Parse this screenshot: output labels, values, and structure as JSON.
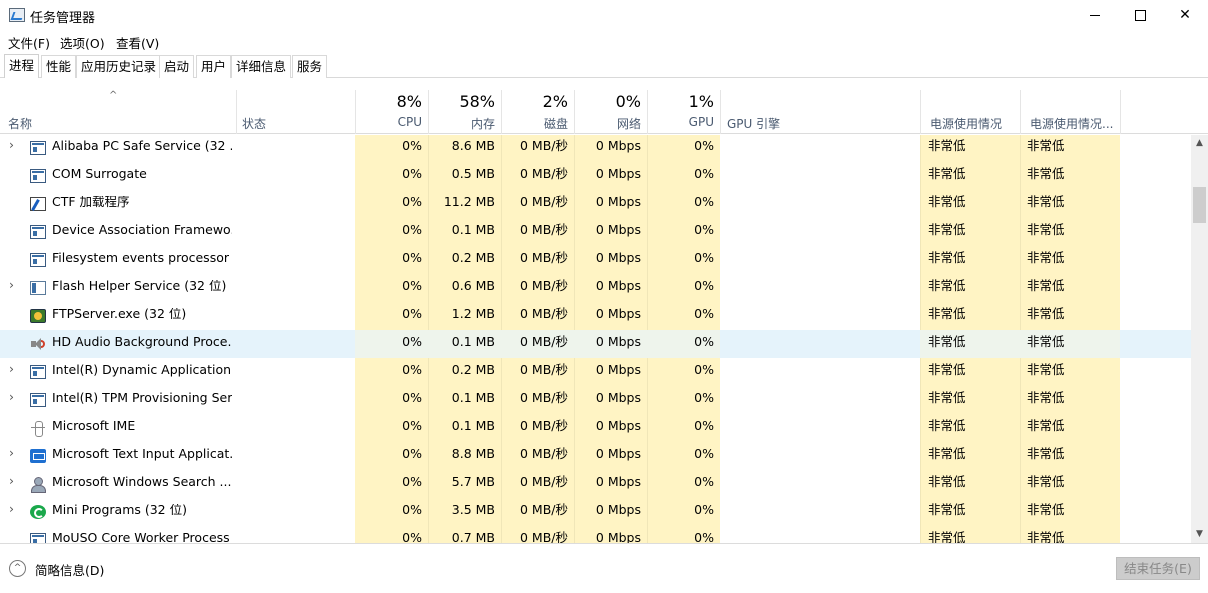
{
  "window": {
    "title": "任务管理器",
    "controls": {
      "minimize": "",
      "maximize": "",
      "close": "✕"
    }
  },
  "menu": [
    "文件(F)",
    "选项(O)",
    "查看(V)"
  ],
  "tabs": [
    "进程",
    "性能",
    "应用历史记录",
    "启动",
    "用户",
    "详细信息",
    "服务"
  ],
  "active_tab": "进程",
  "header": {
    "sort_caret": "^",
    "name": "名称",
    "status": "状态",
    "cpu_pct": "8%",
    "cpu": "CPU",
    "mem_pct": "58%",
    "mem": "内存",
    "disk_pct": "2%",
    "disk": "磁盘",
    "net_pct": "0%",
    "net": "网络",
    "gpu_pct": "1%",
    "gpu": "GPU",
    "gpu_engine": "GPU 引擎",
    "power": "电源使用情况",
    "power_trend": "电源使用情况..."
  },
  "rows": [
    {
      "expand": "›",
      "icon": "window-icon",
      "name": "Alibaba PC Safe Service (32 ...",
      "cpu": "0%",
      "mem": "8.6 MB",
      "disk": "0 MB/秒",
      "net": "0 Mbps",
      "gpu": "0%",
      "power": "非常低",
      "power_trend": "非常低"
    },
    {
      "expand": "",
      "icon": "window-icon",
      "name": "COM Surrogate",
      "cpu": "0%",
      "mem": "0.5 MB",
      "disk": "0 MB/秒",
      "net": "0 Mbps",
      "gpu": "0%",
      "power": "非常低",
      "power_trend": "非常低"
    },
    {
      "expand": "",
      "icon": "ctf-icon",
      "name": "CTF 加载程序",
      "cpu": "0%",
      "mem": "11.2 MB",
      "disk": "0 MB/秒",
      "net": "0 Mbps",
      "gpu": "0%",
      "power": "非常低",
      "power_trend": "非常低"
    },
    {
      "expand": "",
      "icon": "window-icon",
      "name": "Device Association Framewo...",
      "cpu": "0%",
      "mem": "0.1 MB",
      "disk": "0 MB/秒",
      "net": "0 Mbps",
      "gpu": "0%",
      "power": "非常低",
      "power_trend": "非常低"
    },
    {
      "expand": "",
      "icon": "window-icon",
      "name": "Filesystem events processor",
      "cpu": "0%",
      "mem": "0.2 MB",
      "disk": "0 MB/秒",
      "net": "0 Mbps",
      "gpu": "0%",
      "power": "非常低",
      "power_trend": "非常低"
    },
    {
      "expand": "›",
      "icon": "flash-icon",
      "name": "Flash Helper Service (32 位)",
      "cpu": "0%",
      "mem": "0.6 MB",
      "disk": "0 MB/秒",
      "net": "0 Mbps",
      "gpu": "0%",
      "power": "非常低",
      "power_trend": "非常低"
    },
    {
      "expand": "",
      "icon": "ftp-icon",
      "name": "FTPServer.exe (32 位)",
      "cpu": "0%",
      "mem": "1.2 MB",
      "disk": "0 MB/秒",
      "net": "0 Mbps",
      "gpu": "0%",
      "power": "非常低",
      "power_trend": "非常低"
    },
    {
      "expand": "",
      "icon": "speaker-icon",
      "name": "HD Audio Background Proce...",
      "cpu": "0%",
      "mem": "0.1 MB",
      "disk": "0 MB/秒",
      "net": "0 Mbps",
      "gpu": "0%",
      "power": "非常低",
      "power_trend": "非常低",
      "highlight": true
    },
    {
      "expand": "›",
      "icon": "window-icon",
      "name": "Intel(R) Dynamic Application ...",
      "cpu": "0%",
      "mem": "0.2 MB",
      "disk": "0 MB/秒",
      "net": "0 Mbps",
      "gpu": "0%",
      "power": "非常低",
      "power_trend": "非常低"
    },
    {
      "expand": "›",
      "icon": "window-icon",
      "name": "Intel(R) TPM Provisioning Ser...",
      "cpu": "0%",
      "mem": "0.1 MB",
      "disk": "0 MB/秒",
      "net": "0 Mbps",
      "gpu": "0%",
      "power": "非常低",
      "power_trend": "非常低"
    },
    {
      "expand": "",
      "icon": "ime-icon",
      "name": "Microsoft IME",
      "cpu": "0%",
      "mem": "0.1 MB",
      "disk": "0 MB/秒",
      "net": "0 Mbps",
      "gpu": "0%",
      "power": "非常低",
      "power_trend": "非常低"
    },
    {
      "expand": "›",
      "icon": "keyboard-icon",
      "name": "Microsoft Text Input Applicat...",
      "cpu": "0%",
      "mem": "8.8 MB",
      "disk": "0 MB/秒",
      "net": "0 Mbps",
      "gpu": "0%",
      "power": "非常低",
      "power_trend": "非常低"
    },
    {
      "expand": "›",
      "icon": "search-user-icon",
      "name": "Microsoft Windows Search ...",
      "cpu": "0%",
      "mem": "5.7 MB",
      "disk": "0 MB/秒",
      "net": "0 Mbps",
      "gpu": "0%",
      "power": "非常低",
      "power_trend": "非常低"
    },
    {
      "expand": "›",
      "icon": "mini-programs-icon",
      "name": "Mini Programs (32 位)",
      "cpu": "0%",
      "mem": "3.5 MB",
      "disk": "0 MB/秒",
      "net": "0 Mbps",
      "gpu": "0%",
      "power": "非常低",
      "power_trend": "非常低"
    },
    {
      "expand": "",
      "icon": "window-icon",
      "name": "MoUSO Core Worker Process",
      "cpu": "0%",
      "mem": "0.7 MB",
      "disk": "0 MB/秒",
      "net": "0 Mbps",
      "gpu": "0%",
      "power": "非常低",
      "power_trend": "非常低"
    }
  ],
  "scrollbar": {
    "up": "▲",
    "down": "▼"
  },
  "footer": {
    "fewer_details_icon": "^",
    "fewer_details": "简略信息(D)",
    "end_task": "结束任务(E)"
  }
}
